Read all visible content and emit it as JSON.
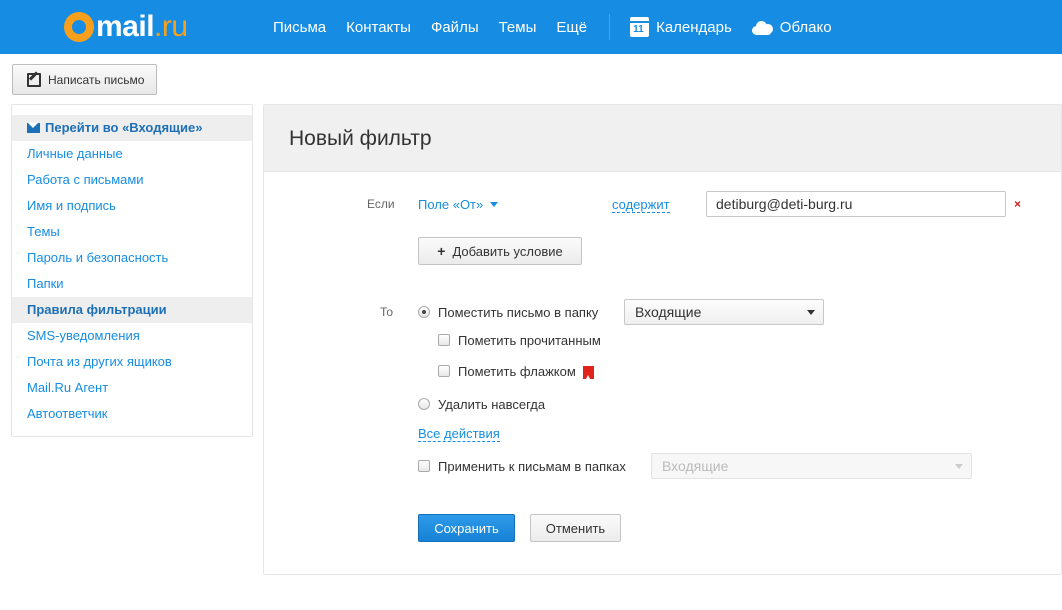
{
  "header": {
    "logo_main": "mail",
    "logo_domain": ".ru",
    "nav": [
      {
        "label": "Письма"
      },
      {
        "label": "Контакты"
      },
      {
        "label": "Файлы"
      },
      {
        "label": "Темы"
      },
      {
        "label": "Ещё"
      }
    ],
    "calendar": {
      "label": "Календарь",
      "icon": "calendar-icon",
      "day": "11"
    },
    "cloud": {
      "label": "Облако",
      "icon": "cloud-icon"
    },
    "colors": {
      "bar": "#168de2",
      "logo_accent": "#f8a01b"
    }
  },
  "compose": {
    "label": "Написать письмо",
    "icon": "pencil-icon"
  },
  "sidebar": {
    "inbox_link": "Перейти во «Входящие»",
    "items": [
      {
        "label": "Личные данные"
      },
      {
        "label": "Работа с письмами"
      },
      {
        "label": "Имя и подпись"
      },
      {
        "label": "Темы"
      },
      {
        "label": "Пароль и безопасность"
      },
      {
        "label": "Папки"
      },
      {
        "label": "Правила фильтрации",
        "active": true
      },
      {
        "label": "SMS-уведомления"
      },
      {
        "label": "Почта из других ящиков"
      },
      {
        "label": "Mail.Ru Агент"
      },
      {
        "label": "Автоответчик"
      }
    ]
  },
  "filter": {
    "title": "Новый фильтр",
    "if_label": "Если",
    "field_dropdown": "Поле «От»",
    "operator": "содержит",
    "value": "detiburg@deti-burg.ru",
    "remove_label": "×",
    "add_condition": "Добавить условие",
    "then_label": "То",
    "move_to_folder": "Поместить письмо в папку",
    "folder_select": "Входящие",
    "mark_read": "Пометить прочитанным",
    "mark_flag": "Пометить флажком",
    "delete_forever": "Удалить навсегда",
    "all_actions": "Все действия",
    "apply_to_folders": "Применить к письмам в папках",
    "apply_folder_select": "Входящие",
    "save": "Сохранить",
    "cancel": "Отменить",
    "state": {
      "move_to_folder": true,
      "delete_forever": false,
      "mark_read": false,
      "mark_flag": false,
      "apply_to_folders": false
    },
    "colors": {
      "flag": "#e0241b",
      "primary": "#1782d6"
    }
  }
}
